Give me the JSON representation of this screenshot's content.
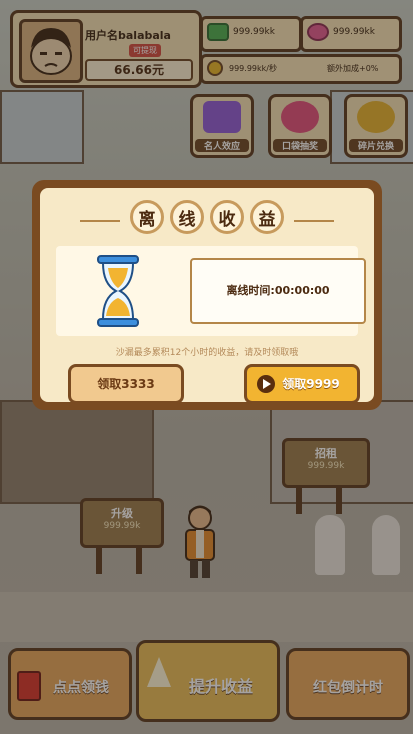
{
  "profile": {
    "username": "用户名balabala",
    "verify_badge": "可提现",
    "money": "66.66元"
  },
  "currencies": [
    {
      "icon": "cash-stack-icon",
      "value": "999.99kk",
      "color": "#4caf50"
    },
    {
      "icon": "pink-lips-icon",
      "value": "999.99kk",
      "color": "#e25a8f"
    }
  ],
  "rate": {
    "value": "999.99kk/秒",
    "bonus": "额外加成+0%"
  },
  "features": [
    {
      "name": "名人效应",
      "icon": "celebrity-icon",
      "color": "#8f5bd6"
    },
    {
      "name": "口袋抽奖",
      "icon": "lips-lottery-icon",
      "color": "#e24f7a"
    },
    {
      "name": "碎片兑换",
      "icon": "fragment-exchange-icon",
      "color": "#e5b22d"
    }
  ],
  "shop_signs": [
    {
      "title": "升级",
      "value": "999.99k"
    },
    {
      "title": "招租",
      "value": "999.99k"
    }
  ],
  "bottom_buttons": [
    {
      "label": "点点领钱"
    },
    {
      "label": "提升收益"
    },
    {
      "label": "红包倒计时"
    }
  ],
  "modal": {
    "title_chars": [
      "离",
      "线",
      "收",
      "益"
    ],
    "offline_time_label": "离线时间:00:00:00",
    "tip": "沙漏最多累积12个小时的收益，请及时领取哦",
    "claim_button": "领取3333",
    "claim_video_button": "领取9999"
  }
}
